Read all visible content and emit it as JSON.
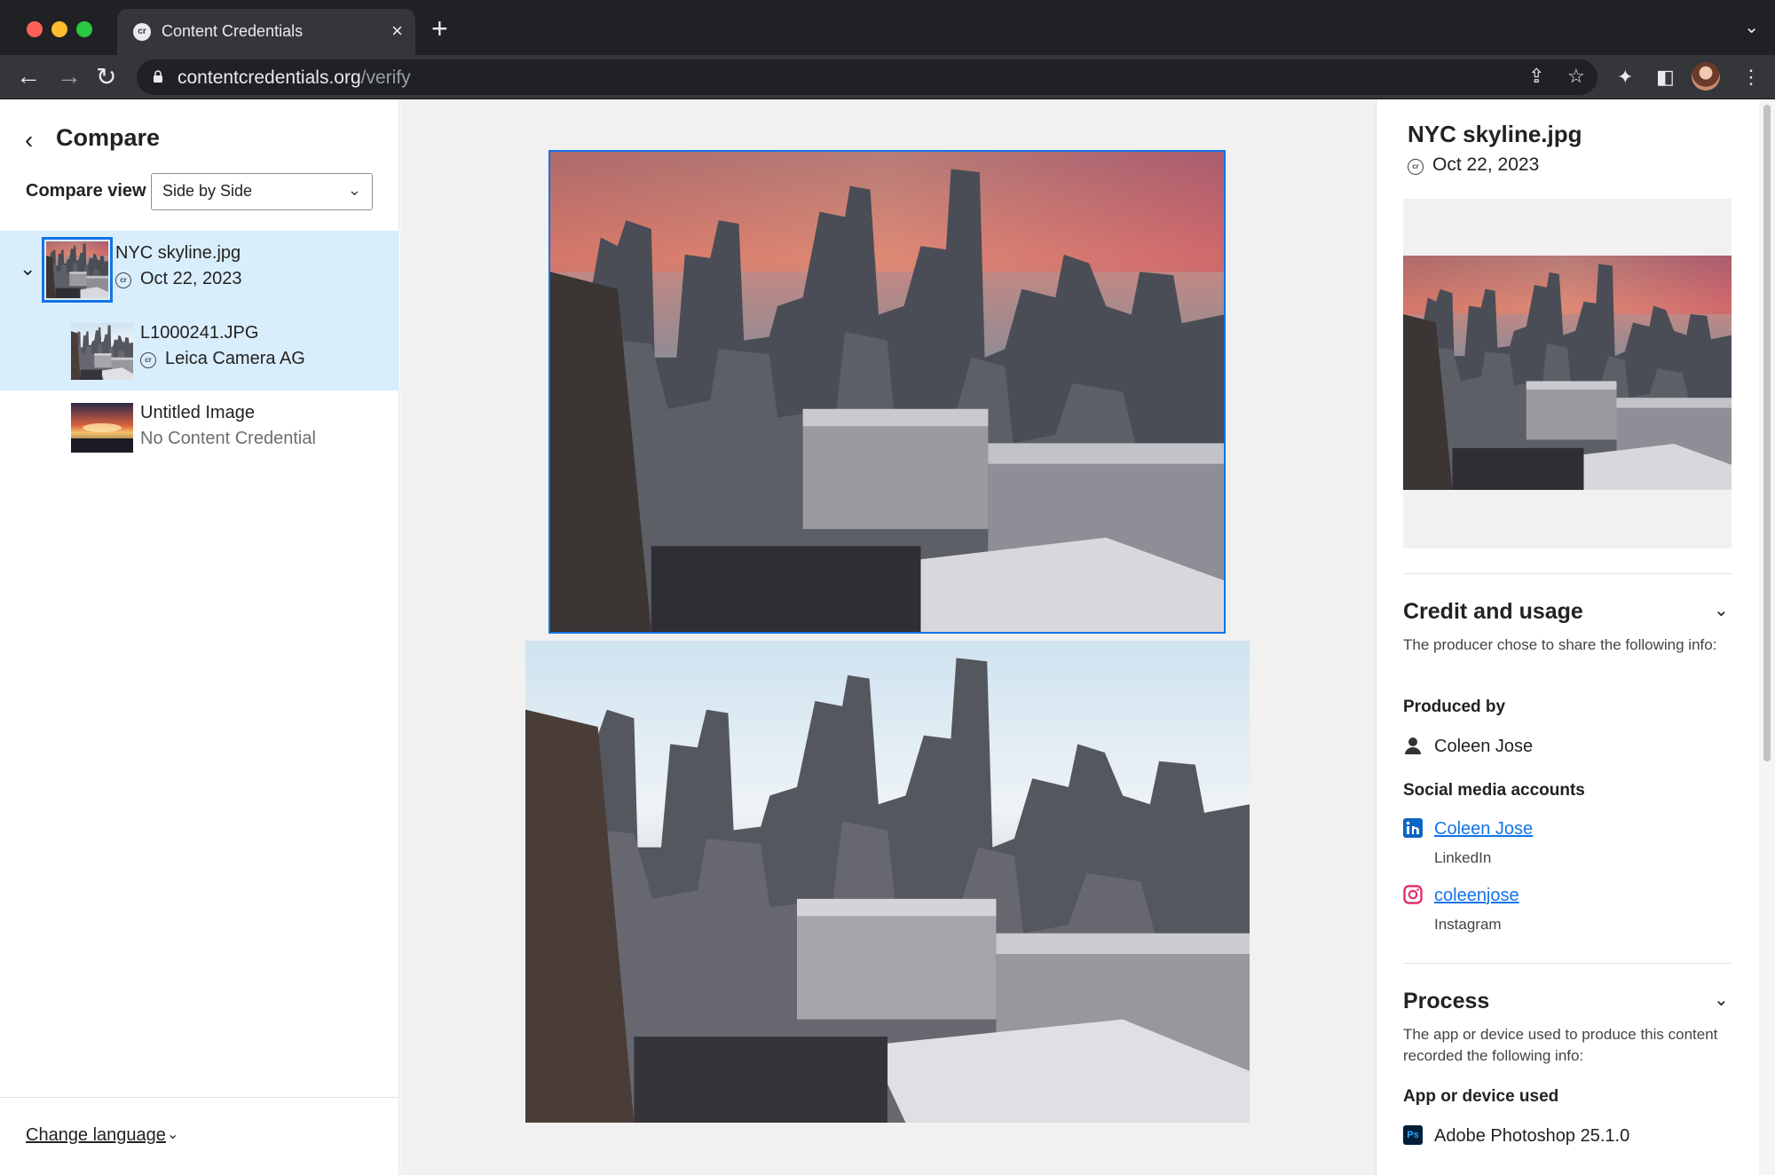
{
  "browser": {
    "tab_title": "Content Credentials",
    "tab_favicon": "cr",
    "url_domain": "contentcredentials.org",
    "url_path": "/verify"
  },
  "left_panel": {
    "title": "Compare",
    "compare_view_label": "Compare view",
    "compare_view_value": "Side by Side",
    "items": [
      {
        "name": "NYC skyline.jpg",
        "sub": "Oct 22, 2023",
        "selected": true
      },
      {
        "name": "L1000241.JPG",
        "sub": "Leica Camera AG"
      },
      {
        "name": "Untitled Image",
        "sub": "No Content Credential"
      }
    ],
    "change_language": "Change language"
  },
  "right_panel": {
    "title": "NYC skyline.jpg",
    "date": "Oct 22, 2023",
    "credit": {
      "title": "Credit and usage",
      "desc": "The producer chose to share the following info:",
      "produced_by_label": "Produced by",
      "producer": "Coleen Jose",
      "social_label": "Social media accounts",
      "linkedin_name": "Coleen Jose",
      "linkedin_label": "LinkedIn",
      "instagram_name": "coleenjose",
      "instagram_label": "Instagram"
    },
    "process": {
      "title": "Process",
      "desc": "The app or device used to produce this content recorded the following info:",
      "app_label": "App or device used",
      "app_value": "Adobe Photoshop 25.1.0",
      "app_icon_text": "Ps"
    }
  },
  "colors": {
    "accent": "#1473e6",
    "selected_row": "#d9eefc",
    "chrome_dark": "#202124",
    "chrome_toolbar": "#35363a"
  },
  "icons": [
    "back-icon",
    "forward-icon",
    "reload-icon",
    "lock-icon",
    "share-icon",
    "star-icon",
    "extensions-icon",
    "sidepanel-icon",
    "menu-icon",
    "chevron-left-icon",
    "chevron-down-icon",
    "content-credential-icon",
    "person-icon",
    "linkedin-icon",
    "instagram-icon",
    "photoshop-icon"
  ]
}
